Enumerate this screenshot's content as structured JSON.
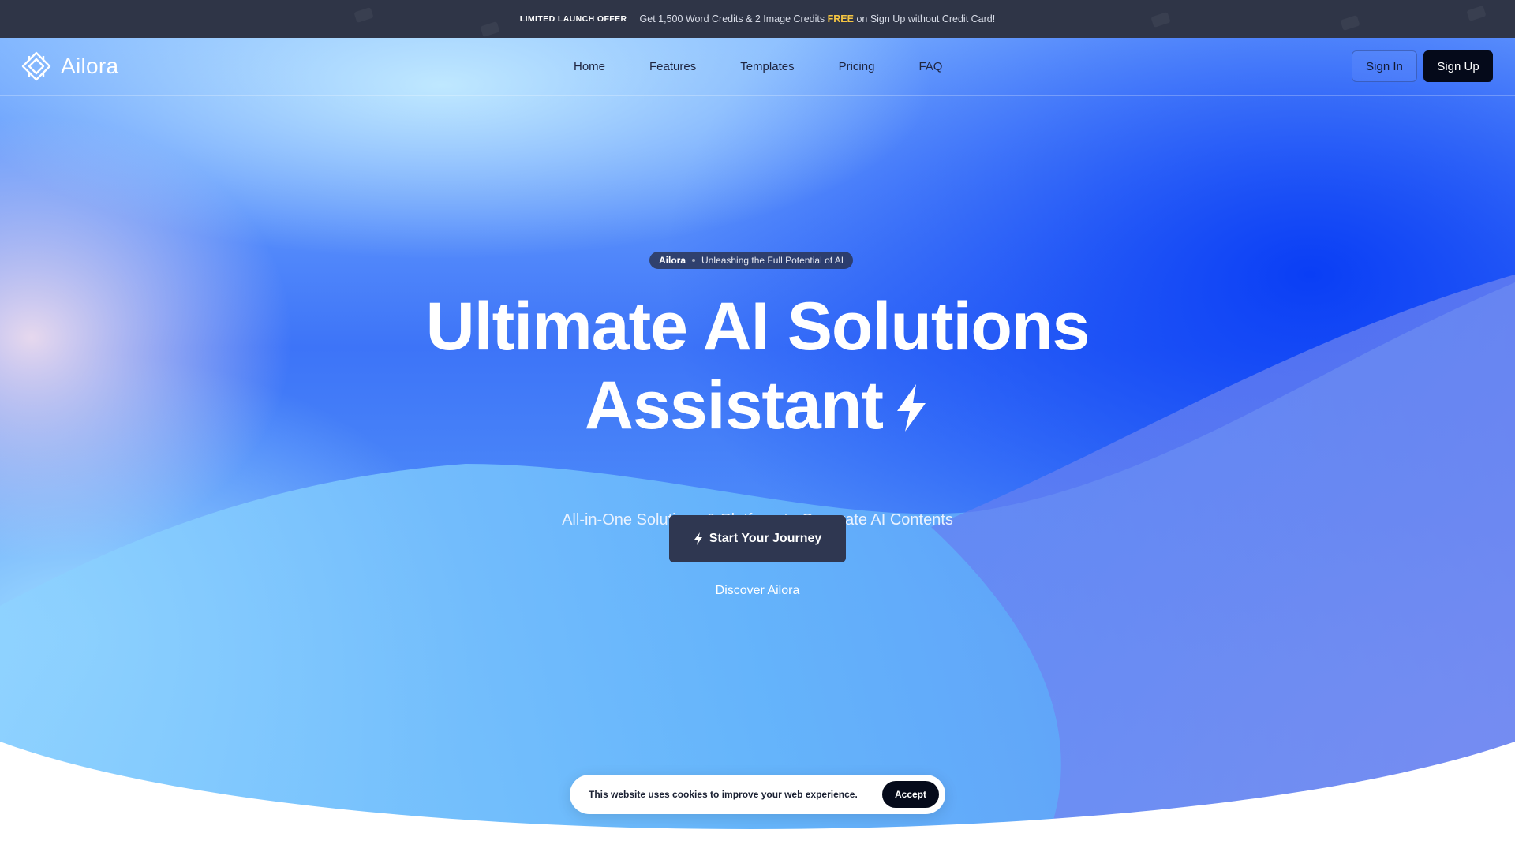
{
  "announcement": {
    "tag": "LIMITED LAUNCH OFFER",
    "message_prefix": "Get 1,500 Word Credits & 2 Image Credits",
    "highlight": "FREE",
    "message_suffix": "on Sign Up without Credit Card!"
  },
  "header": {
    "logo_text": "Ailora",
    "nav": [
      "Home",
      "Features",
      "Templates",
      "Pricing",
      "FAQ"
    ],
    "sign_in": "Sign In",
    "sign_up": "Sign Up"
  },
  "hero": {
    "pill_brand": "Ailora",
    "pill_text": "Unleashing the Full Potential of AI",
    "title_line1": "Ultimate AI Solutions",
    "title_line2": "Assistant",
    "subtitle": "All-in-One Solutions & Platform to Generate AI Contents",
    "cta_label": "Start Your Journey",
    "discover_label": "Discover Ailora",
    "icon": "lightning-bolt-icon"
  },
  "cookie_banner": {
    "text": "This website uses cookies to improve your web experience.",
    "accept": "Accept"
  },
  "colors": {
    "announcement_bg": "#2f3547",
    "highlight": "#f5c542",
    "hero_blue": "#0a3ef5",
    "cta_bg": "#2f3751",
    "dark_button": "#050a1a"
  }
}
